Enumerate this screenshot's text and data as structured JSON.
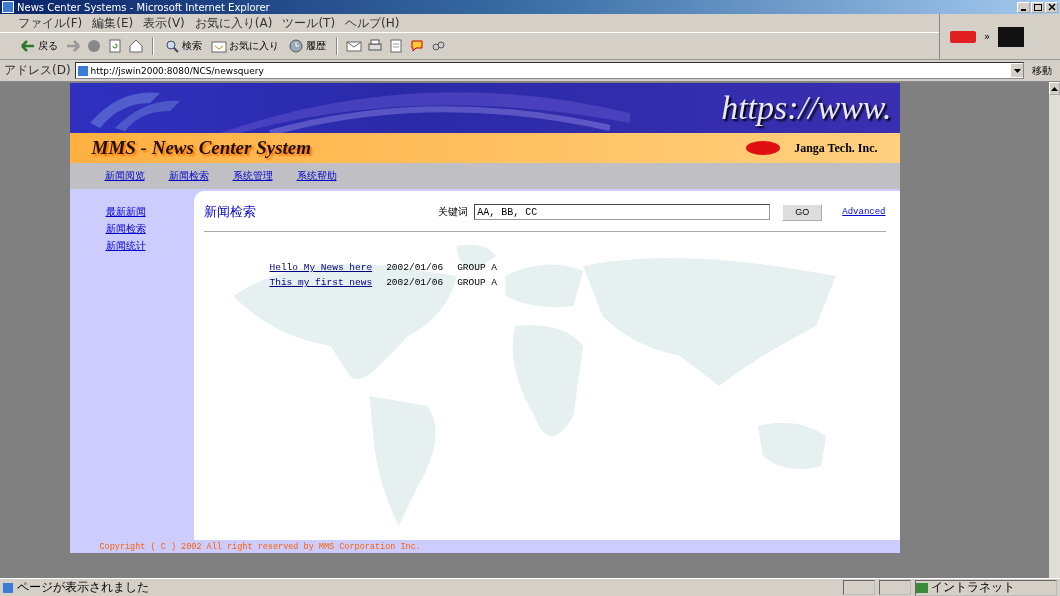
{
  "window": {
    "title": "News Center Systems - Microsoft Internet Explorer"
  },
  "menu": [
    "ファイル(F)",
    "編集(E)",
    "表示(V)",
    "お気に入り(A)",
    "ツール(T)",
    "ヘルプ(H)"
  ],
  "toolbar": [
    {
      "kind": "back",
      "label": "戻る"
    },
    {
      "kind": "forward"
    },
    {
      "kind": "stop"
    },
    {
      "kind": "refresh"
    },
    {
      "kind": "home"
    },
    {
      "kind": "search",
      "label": "検索"
    },
    {
      "kind": "favorites",
      "label": "お気に入り"
    },
    {
      "kind": "history",
      "label": "履歴"
    },
    {
      "kind": "mail"
    },
    {
      "kind": "print"
    },
    {
      "kind": "edit"
    },
    {
      "kind": "discuss"
    },
    {
      "kind": "messenger"
    }
  ],
  "more": "»",
  "address": {
    "label": "アドレス(D)",
    "url": "http://jswin2000:8080/NCS/newsquery",
    "go": "移動"
  },
  "page": {
    "banner": "https://www.",
    "brand": "MMS - News Center System",
    "company": "Janga Tech. Inc.",
    "nav": [
      "新闻阅览",
      "新闻检索",
      "系统管理",
      "系统帮助"
    ],
    "sidebar": [
      "最新新闻",
      "新闻检索",
      "新闻统计"
    ],
    "heading": "新闻检索",
    "search": {
      "label": "关键词",
      "value": "AA, BB, CC",
      "button": "GO",
      "advanced": "Advanced"
    },
    "results": [
      {
        "title": "Hello My News here",
        "date": "2002/01/06",
        "group": "GROUP A"
      },
      {
        "title": "This my first news",
        "date": "2002/01/06",
        "group": "GROUP A"
      }
    ],
    "footer": "Copyright ( C ) 2002 All right reserved by MMS Corporation Inc."
  },
  "status_bar": {
    "message": "ページが表示されました",
    "zone": "イントラネット"
  }
}
